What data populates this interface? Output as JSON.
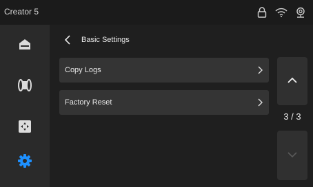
{
  "status_bar": {
    "title": "Creator 5",
    "icons": [
      "lock-icon",
      "wifi-icon",
      "webcam-icon"
    ]
  },
  "sidebar": {
    "items": [
      {
        "name": "home",
        "icon": "home-icon",
        "active": false
      },
      {
        "name": "filament",
        "icon": "filament-spool-icon",
        "active": false
      },
      {
        "name": "calibration",
        "icon": "move-axis-icon",
        "active": false
      },
      {
        "name": "settings",
        "icon": "gear-icon",
        "active": true
      }
    ]
  },
  "header": {
    "back_icon": "chevron-left-icon",
    "title": "Basic Settings"
  },
  "list": {
    "items": [
      {
        "label": "Copy Logs",
        "icon": "chevron-right-icon"
      },
      {
        "label": "Factory Reset",
        "icon": "chevron-right-icon"
      }
    ]
  },
  "pager": {
    "indicator": "3 / 3",
    "up_icon": "chevron-up-icon",
    "down_icon": "chevron-down-icon"
  },
  "colors": {
    "background": "#1f1f1f",
    "sidebar": "#2a2a2a",
    "row": "#343434",
    "accent": "#1e90ff",
    "disabled": "#5a5a5a"
  }
}
